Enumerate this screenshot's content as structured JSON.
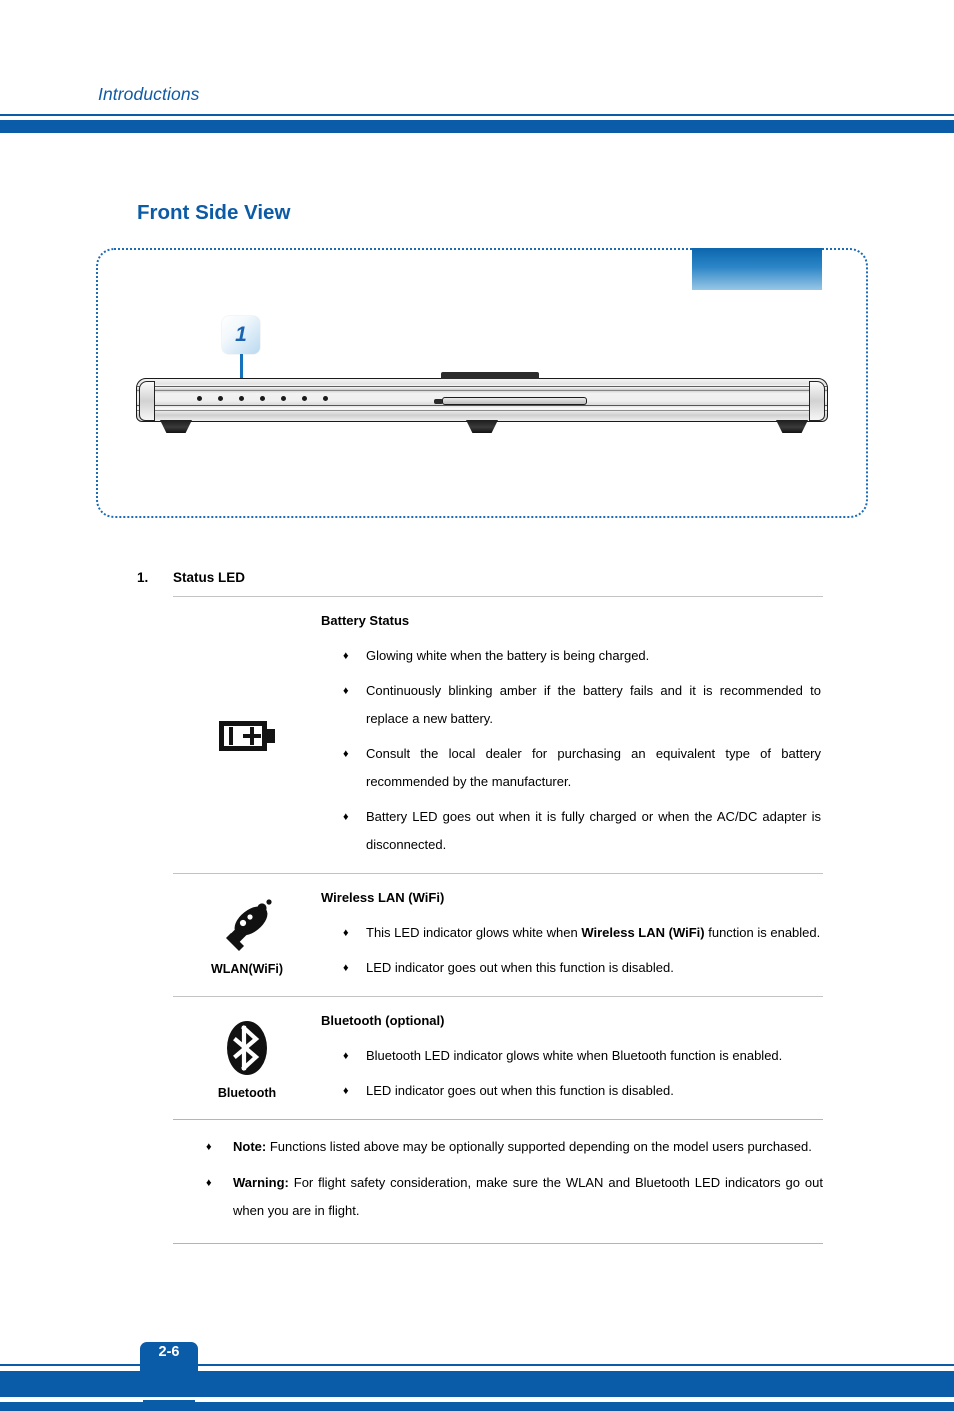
{
  "header": {
    "title": "Introductions",
    "accent_color": "#0B5BA6"
  },
  "section": {
    "title": "Front Side View"
  },
  "diagram": {
    "callout_number": "1",
    "led_count": 7,
    "icons": {
      "callout_badge": "number-callout-badge",
      "pointer": "callout-pointer-arrow",
      "device": "laptop-front-view-illustration"
    }
  },
  "item": {
    "index": "1.",
    "label": "Status LED"
  },
  "table": {
    "rows": [
      {
        "icon_name": "battery-icon",
        "icon_caption": "",
        "title": "Battery Status",
        "bullets": [
          {
            "text": "Glowing white when the battery is being charged."
          },
          {
            "text": "Continuously blinking amber if the battery fails and it is recommended to replace a new battery."
          },
          {
            "text": "Consult the local dealer for purchasing an equivalent type of battery recommended by the manufacturer."
          },
          {
            "text": "Battery LED goes out when it is fully charged or when the AC/DC adapter is disconnected."
          }
        ]
      },
      {
        "icon_name": "wlan-satellite-icon",
        "icon_caption": "WLAN(WiFi)",
        "title": "Wireless LAN (WiFi)",
        "bullets": [
          {
            "pre": "This LED indicator glows white when ",
            "bold": "Wireless LAN (WiFi)",
            "post": " function is enabled."
          },
          {
            "text": "LED indicator goes out when this function is disabled."
          }
        ]
      },
      {
        "icon_name": "bluetooth-icon",
        "icon_caption": "Bluetooth",
        "title": "Bluetooth (optional)",
        "bullets": [
          {
            "text": "Bluetooth LED indicator glows white when Bluetooth function is enabled."
          },
          {
            "text": "LED indicator goes out when this function is disabled."
          }
        ]
      }
    ]
  },
  "notes": [
    {
      "label": "Note:",
      "text": " Functions listed above may be optionally supported depending on the model users purchased."
    },
    {
      "label": "Warning:",
      "text": " For flight safety consideration, make sure the WLAN and Bluetooth LED indicators go out when you are in flight."
    }
  ],
  "footer": {
    "page_number": "2-6"
  },
  "bullet_glyph": "♦"
}
